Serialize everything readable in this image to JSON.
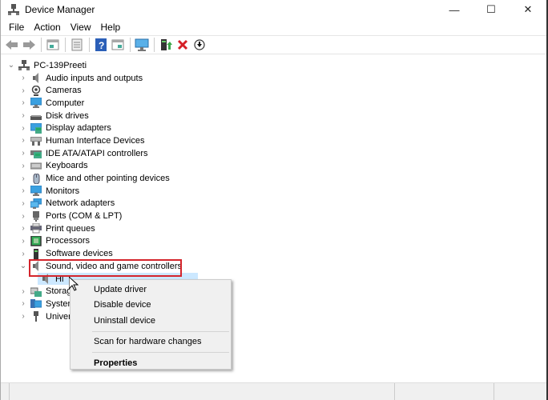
{
  "window": {
    "title": "Device Manager",
    "controls": {
      "minimize": "—",
      "maximize": "☐",
      "close": "✕"
    }
  },
  "menubar": [
    "File",
    "Action",
    "View",
    "Help"
  ],
  "toolbar": {
    "buttons": [
      "back-icon",
      "forward-icon",
      "show-hide-console-tree-icon",
      "properties-icon",
      "help-icon",
      "action-pane-icon",
      "scan-hardware-icon",
      "update-driver-icon",
      "uninstall-icon",
      "download-icon"
    ]
  },
  "tree": {
    "root": "PC-139Preeti",
    "categories": [
      {
        "label": "Audio inputs and outputs",
        "icon": "speaker-icon"
      },
      {
        "label": "Cameras",
        "icon": "camera-icon"
      },
      {
        "label": "Computer",
        "icon": "computer-icon"
      },
      {
        "label": "Disk drives",
        "icon": "disk-drive-icon"
      },
      {
        "label": "Display adapters",
        "icon": "display-adapter-icon"
      },
      {
        "label": "Human Interface Devices",
        "icon": "hid-icon"
      },
      {
        "label": "IDE ATA/ATAPI controllers",
        "icon": "ide-controller-icon"
      },
      {
        "label": "Keyboards",
        "icon": "keyboard-icon"
      },
      {
        "label": "Mice and other pointing devices",
        "icon": "mouse-icon"
      },
      {
        "label": "Monitors",
        "icon": "monitor-icon"
      },
      {
        "label": "Network adapters",
        "icon": "network-adapter-icon"
      },
      {
        "label": "Ports (COM & LPT)",
        "icon": "port-icon"
      },
      {
        "label": "Print queues",
        "icon": "printer-icon"
      },
      {
        "label": "Processors",
        "icon": "processor-icon"
      },
      {
        "label": "Software devices",
        "icon": "software-device-icon"
      },
      {
        "label": "Sound, video and game controllers",
        "icon": "speaker-icon",
        "expanded": true
      },
      {
        "label": "Storage controllers",
        "icon": "storage-controller-icon",
        "visible_text": "Storag"
      },
      {
        "label": "System devices",
        "icon": "system-device-icon",
        "visible_text": "Syster"
      },
      {
        "label": "Universal Serial Bus controllers",
        "icon": "usb-icon",
        "visible_text": "Univer"
      }
    ],
    "child_device": {
      "visible_text": "Hi",
      "icon": "speaker-icon"
    }
  },
  "context_menu": {
    "items": [
      "Update driver",
      "Disable device",
      "Uninstall device"
    ],
    "scan": "Scan for hardware changes",
    "properties": "Properties"
  },
  "colors": {
    "highlight_border": "#d4252c",
    "selection": "#cce8ff",
    "menu_bg": "#f0f0f0"
  }
}
